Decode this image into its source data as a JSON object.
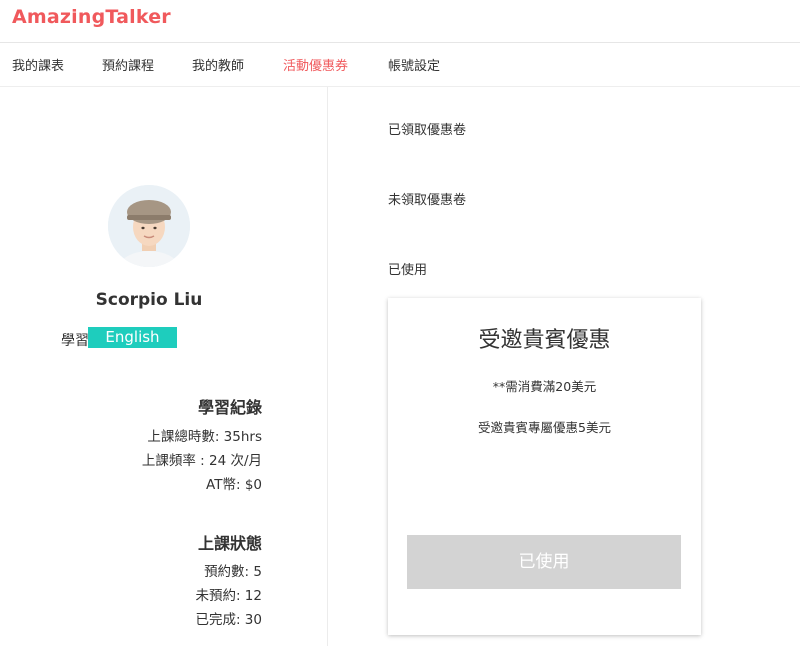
{
  "app": {
    "logo": "AmazingTalker"
  },
  "nav": {
    "items": [
      {
        "label": "我的課表"
      },
      {
        "label": "預約課程"
      },
      {
        "label": "我的教師"
      },
      {
        "label": "活動優惠券"
      },
      {
        "label": "帳號設定"
      }
    ],
    "active": "活動優惠券"
  },
  "profile": {
    "name": "Scorpio Liu",
    "learn_label": "學習",
    "language": "English"
  },
  "study_record": {
    "title": "學習紀錄",
    "lines": [
      "上課總時數: 35hrs",
      "上課頻率 : 24 次/月",
      "AT幣: $0"
    ]
  },
  "class_status": {
    "title": "上課狀態",
    "lines": [
      "預約數: 5",
      "未預約: 12",
      "已完成: 30"
    ]
  },
  "coupon_tabs": [
    "已領取優惠卷",
    "未領取優惠卷",
    "已使用"
  ],
  "coupon_card": {
    "title": "受邀貴賓優惠",
    "condition": "**需消費滿20美元",
    "description": "受邀貴賓專屬優惠5美元",
    "button_label": "已使用"
  },
  "colors": {
    "brand": "#f0595c",
    "badge": "#1ecdbd",
    "disabled_button": "#d3d3d3"
  }
}
